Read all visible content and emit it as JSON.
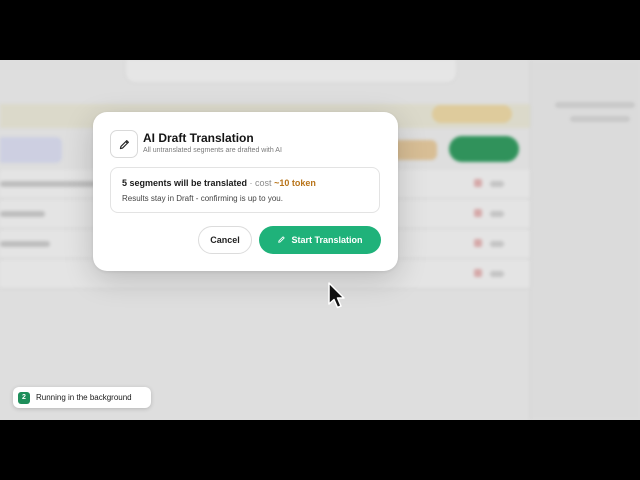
{
  "modal": {
    "title": "AI Draft Translation",
    "subtitle": "All untranslated segments are drafted with AI",
    "summary_bold": "5 segments will be translated",
    "summary_sep": " · cost ",
    "summary_cost": "~10 token",
    "note": "Results stay in Draft - confirming is up to you.",
    "cancel_label": "Cancel",
    "start_label": "Start Translation",
    "icons": {
      "header": "pencil-icon",
      "start": "pencil-icon"
    },
    "colors": {
      "primary": "#1fb27a",
      "cost": "#b8741a"
    }
  },
  "toast": {
    "count": "2",
    "label": "Running in the background"
  }
}
